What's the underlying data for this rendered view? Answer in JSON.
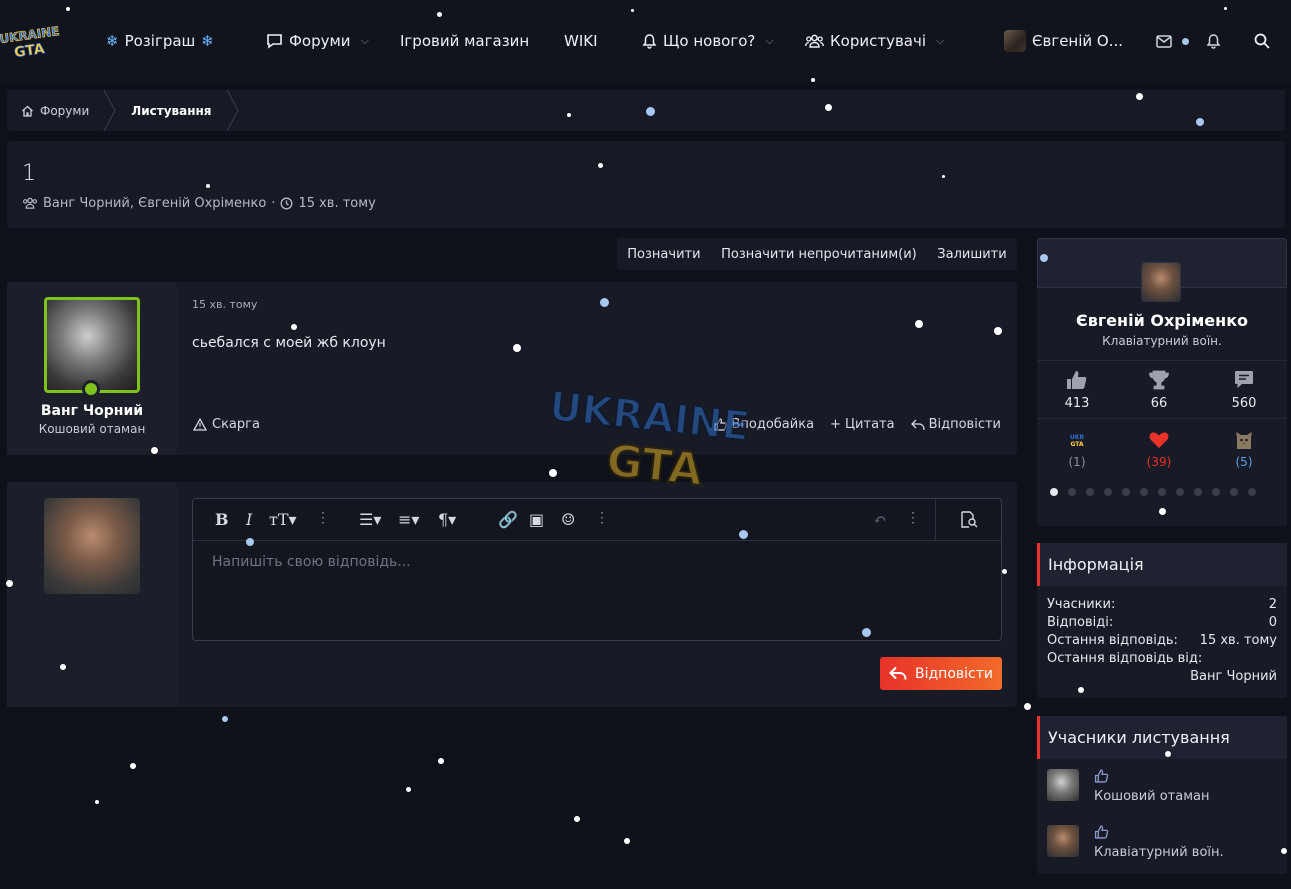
{
  "nav": {
    "logo_text": "UKRAINE GTA",
    "giveaway_label": "Розіграш",
    "forums_label": "Форуми",
    "shop_label": "Ігровий магазин",
    "wiki_label": "WIKI",
    "whats_new_label": "Що нового?",
    "users_label": "Користувачі",
    "account_name": "Євгеній О..."
  },
  "breadcrumb": {
    "home_label": "Форуми",
    "current_label": "Листування"
  },
  "thread": {
    "title": "1",
    "participants": "Ванг Чорний, Євгеній Охріменко",
    "separator": "·",
    "time": "15 хв. тому"
  },
  "actions": {
    "mark": "Позначити",
    "mark_unread": "Позначити непрочитаним(и)",
    "leave": "Залишити"
  },
  "message": {
    "username": "Ванг Чорний",
    "user_title": "Кошовий отаман",
    "time": "15 хв. тому",
    "body": "сьебался с моей жб клоун",
    "report_label": "Скарга",
    "like_label": "Вподобайка",
    "quote_label": "Цитата",
    "reply_label": "Відповісти"
  },
  "reply": {
    "placeholder": "Напишіть свою відповідь...",
    "submit_label": "Відповісти"
  },
  "profile": {
    "name": "Євгеній Охріменко",
    "title": "Клавіатурний воїн.",
    "stats": [
      {
        "icon": "thumbs-up-icon",
        "value": "413"
      },
      {
        "icon": "trophy-icon",
        "value": "66"
      },
      {
        "icon": "message-icon",
        "value": "560"
      }
    ],
    "reactions": [
      {
        "icon": "ukraine-gta-reaction-icon",
        "value": "(1)",
        "color": "#8a8e9a"
      },
      {
        "icon": "heart-icon",
        "value": "(39)",
        "color": "#e8322a"
      },
      {
        "icon": "cat-reaction-icon",
        "value": "(5)",
        "color": "#5aa0e8"
      }
    ]
  },
  "info": {
    "heading": "Інформація",
    "rows": [
      {
        "label": "Учасники:",
        "value": "2"
      },
      {
        "label": "Відповіді:",
        "value": "0"
      },
      {
        "label": "Остання відповідь:",
        "value": "15 хв. тому"
      },
      {
        "label": "Остання відповідь від:",
        "value": ""
      }
    ],
    "last_reply_by": "Ванг Чорний"
  },
  "participants": {
    "heading": "Учасники листування",
    "items": [
      {
        "title": "Кошовий отаман"
      },
      {
        "title": "Клавіатурний воїн."
      }
    ]
  },
  "colors": {
    "accent": "#e8322a",
    "online": "#7dc21e",
    "background": "#0f111a"
  }
}
